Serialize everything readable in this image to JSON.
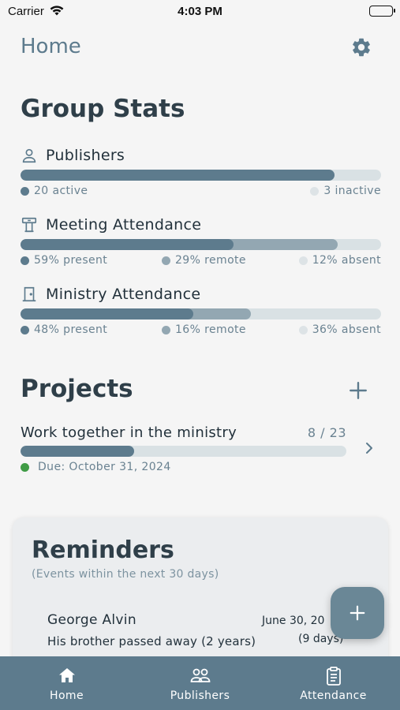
{
  "status_bar": {
    "carrier": "Carrier",
    "time": "4:03 PM"
  },
  "header": {
    "title": "Home",
    "settings_icon": "gear-icon"
  },
  "group_stats": {
    "title": "Group Stats",
    "publishers": {
      "label": "Publishers",
      "icon": "person-icon",
      "active_fraction": 0.87,
      "active_label": "20 active",
      "inactive_label": "3 inactive"
    },
    "meeting_attendance": {
      "label": "Meeting Attendance",
      "icon": "lectern-icon",
      "present_percent": 59,
      "remote_percent": 29,
      "absent_percent": 12,
      "present_label": "59% present",
      "remote_label": "29% remote",
      "absent_label": "12% absent"
    },
    "ministry_attendance": {
      "label": "Ministry Attendance",
      "icon": "door-icon",
      "present_percent": 48,
      "remote_percent": 16,
      "absent_percent": 36,
      "present_label": "48% present",
      "remote_label": "16% remote",
      "absent_label": "36% absent"
    }
  },
  "projects": {
    "title": "Projects",
    "add_icon": "plus-icon",
    "items": [
      {
        "name": "Work together in the ministry",
        "count": "8 / 23",
        "progress_fraction": 0.348,
        "due": "Due: October 31, 2024",
        "due_status_color": "#3f9b45"
      }
    ]
  },
  "reminders": {
    "title": "Reminders",
    "subtitle": "(Events within the next 30 days)",
    "items": [
      {
        "name": "George Alvin",
        "description": "His brother passed away (2 years)",
        "date": "June 30, 20",
        "days": "(9 days)"
      }
    ]
  },
  "fab": {
    "icon": "plus-icon"
  },
  "tabs": [
    {
      "label": "Home",
      "icon": "home-icon"
    },
    {
      "label": "Publishers",
      "icon": "people-icon"
    },
    {
      "label": "Attendance",
      "icon": "clipboard-icon"
    }
  ],
  "colors": {
    "accent": "#5d7b8d",
    "remote": "#93a7b2",
    "track": "#d9e1e4",
    "absent_dot": "#dde3e6",
    "due_green": "#3f9b45"
  }
}
